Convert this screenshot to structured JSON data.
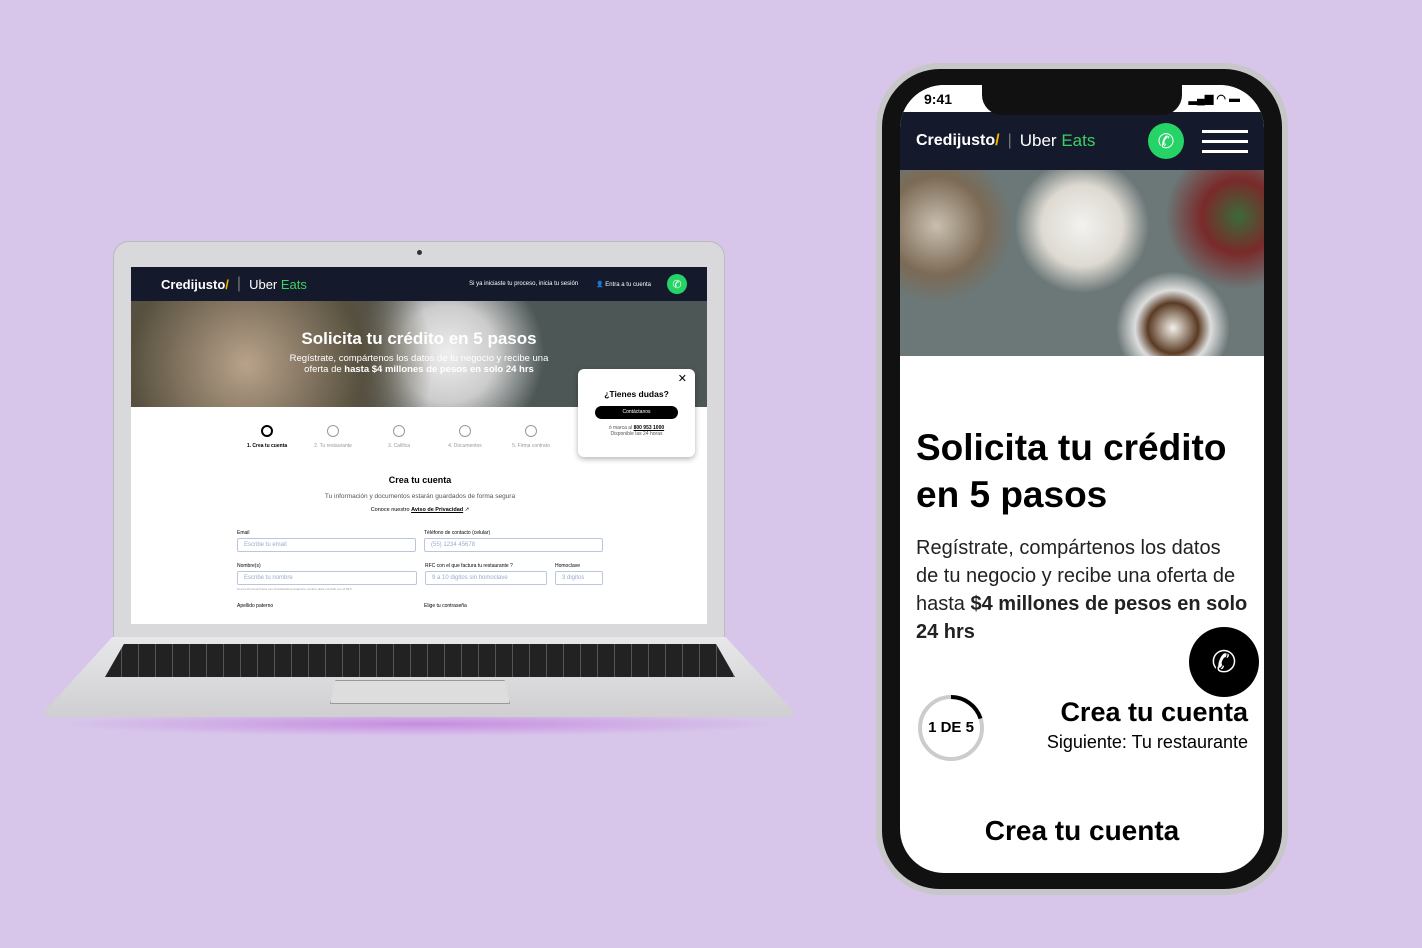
{
  "brand": {
    "credijusto": "Credijusto",
    "slash": "/",
    "uber": "Uber",
    "eats": "Eats"
  },
  "desktop": {
    "nav": {
      "login_hint": "Si ya iniciaste tu proceso, inicia tu sesión",
      "account": "Entra a tu cuenta"
    },
    "hero": {
      "title": "Solicita tu crédito en 5 pasos",
      "line1": "Regístrate, compártenos los datos de tu negocio y recibe una",
      "line2_pre": "oferta de ",
      "line2_bold": "hasta $4 millones de pesos en solo 24 hrs"
    },
    "steps": [
      "1. Crea tu cuenta",
      "2. Tu restaurante",
      "3. Califica",
      "4. Documentos",
      "5. Firma contrato"
    ],
    "popup": {
      "title": "¿Tienes dudas?",
      "button": "Contáctanos",
      "call_pre": "ó marca al ",
      "phone": "800 953 1000",
      "hours": "Disponible las 24 horas"
    },
    "form": {
      "title": "Crea tu cuenta",
      "subtitle": "Tu información y documentos estarán guardados de forma segura",
      "privacy_pre": "Conoce nuestro ",
      "privacy_link": "Aviso de Privacidad",
      "email_label": "Email",
      "email_placeholder": "Escribe tu email",
      "phone_label": "Téléfono de contacto (celular)",
      "phone_placeholder": "(55) 1234 45678",
      "name_label": "Nombre(s)",
      "name_placeholder": "Escribe tu nombre",
      "rfc_label": "RFC con el que factura tu restaurante",
      "rfc_placeholder": "9 a 10 digitos sin homoclave",
      "homoclave_label": "Homoclave",
      "homoclave_placeholder": "3 digitos",
      "name_hint": "Si eres Persona Física con Actividad Empresarial tu nombre debe coincidir con el RFC.",
      "lastname_label": "Apellido paterno",
      "password_label": "Elige tu contraseña"
    }
  },
  "mobile": {
    "time": "9:41",
    "title": "Solicita tu crédito en 5 pasos",
    "body_pre": "Regístrate, compártenos los datos de tu negocio y recibe una oferta de hasta ",
    "body_bold": "$4 millones de pesos en solo 24 hrs",
    "progress_label": "1 DE 5",
    "progress_fraction": 0.2,
    "step_title": "Crea tu cuenta",
    "next": "Siguiente: Tu restaurante",
    "section_title": "Crea tu cuenta"
  },
  "colors": {
    "nav": "#141a2b",
    "eats": "#3fcf63",
    "slash": "#f7b500",
    "whatsapp": "#25d366",
    "background": "#d7c5ea"
  }
}
